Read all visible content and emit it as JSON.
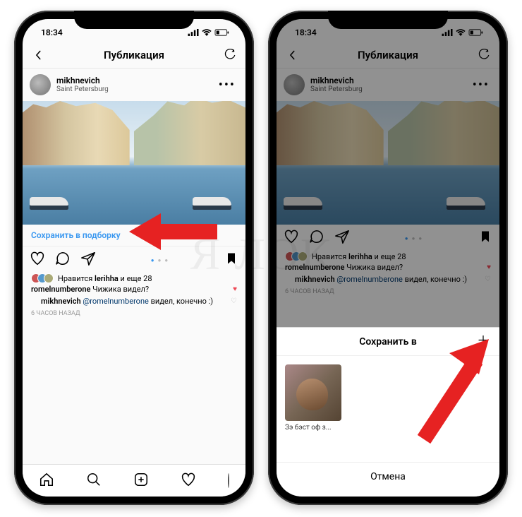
{
  "status": {
    "time": "18:34"
  },
  "nav": {
    "title": "Публикация"
  },
  "post": {
    "username": "mikhnevich",
    "location": "Saint Petersburg",
    "save_prompt": "Сохранить в подборку"
  },
  "likes": {
    "prefix": "Нравится ",
    "user": "lerihha",
    "suffix": " и еще 28"
  },
  "comments": [
    {
      "user": "romelnumberone",
      "text": " Чижика видел?",
      "liked": true
    },
    {
      "user": "mikhnevich",
      "mention": "@romelnumberone",
      "text": " видел, конечно :)",
      "liked": false,
      "reply": true
    }
  ],
  "timeago": "6 ЧАСОВ НАЗАД",
  "sheet": {
    "title": "Сохранить в",
    "collection_label": "Зэ бэст оф з...",
    "cancel": "Отмена"
  },
  "watermark": "Я ЛОК"
}
